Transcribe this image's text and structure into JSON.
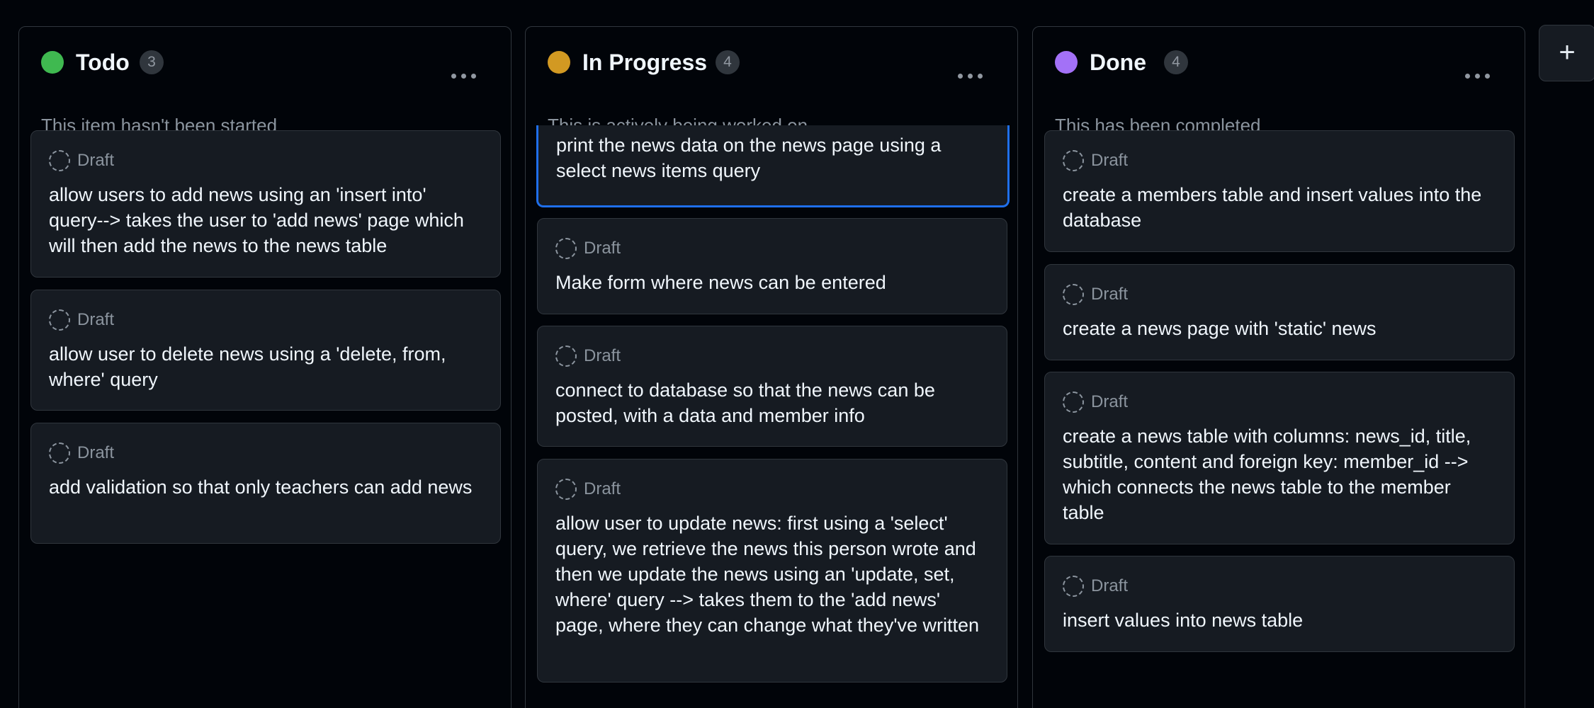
{
  "columns": [
    {
      "title": "Todo",
      "count": "3",
      "description": "This item hasn't been started",
      "color": "#3fb950",
      "cards": [
        {
          "status": "Draft",
          "title": "allow users to add news using an 'insert into' query--> takes the user to 'add news' page which will then add the news to the news table"
        },
        {
          "status": "Draft",
          "title": "allow user to delete news using a 'delete, from, where' query"
        },
        {
          "status": "Draft",
          "title": "add validation so that only teachers can add news"
        }
      ]
    },
    {
      "title": "In Progress",
      "count": "4",
      "description": "This is actively being worked on",
      "color": "#d29922",
      "cards": [
        {
          "status": "",
          "title": "print the news data on the news page using a select news items query"
        },
        {
          "status": "Draft",
          "title": "Make form where news can be entered"
        },
        {
          "status": "Draft",
          "title": "connect to database so that the news can be posted, with a data and member info"
        },
        {
          "status": "Draft",
          "title": "allow user to update news: first using a 'select' query, we retrieve the news this person wrote and then we update the news using an 'update, set, where' query --> takes them to the 'add news' page, where they can change what they've written"
        }
      ]
    },
    {
      "title": "Done",
      "count": "4",
      "description": "This has been completed",
      "color": "#a371f7",
      "cards": [
        {
          "status": "Draft",
          "title": "create a members table and insert values into the database"
        },
        {
          "status": "Draft",
          "title": "create a news page with 'static' news"
        },
        {
          "status": "Draft",
          "title": "create a news table with columns: news_id, title, subtitle, content and foreign key: member_id --> which connects the news table to the member table"
        },
        {
          "status": "Draft",
          "title": "insert values into news table"
        }
      ]
    }
  ],
  "add_column": {
    "icon": "plus-icon",
    "label": "+"
  }
}
